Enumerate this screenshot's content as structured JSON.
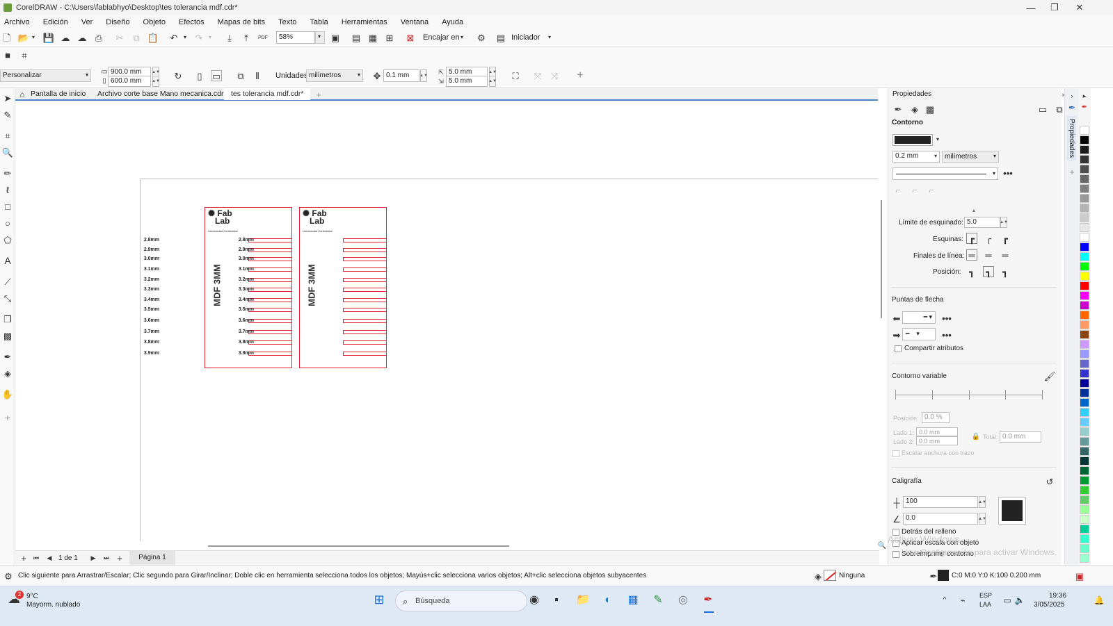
{
  "window": {
    "title": "CorelDRAW - C:\\Users\\fablabhyo\\Desktop\\tes tolerancia mdf.cdr*",
    "minimize": "—",
    "restore": "❐",
    "close": "✕"
  },
  "menu": [
    "Archivo",
    "Edición",
    "Ver",
    "Diseño",
    "Objeto",
    "Efectos",
    "Mapas de bits",
    "Texto",
    "Tabla",
    "Herramientas",
    "Ventana",
    "Ayuda"
  ],
  "toolbar": {
    "zoom": "58%",
    "fit_label": "Encajar en",
    "launcher_label": "Iniciador",
    "pdf_label": "PDF"
  },
  "propbar": {
    "preset": "Personalizar",
    "width": "900.0 mm",
    "height": "600.0 mm",
    "units_label": "Unidades:",
    "units": "milímetros",
    "nudge": "0.1 mm",
    "dup_x": "5.0 mm",
    "dup_y": "5.0 mm"
  },
  "tabs": [
    {
      "label": "Pantalla de inicio"
    },
    {
      "label": "Archivo corte base Mano mecanica.cdr"
    },
    {
      "label": "tes tolerancia mdf.cdr*"
    }
  ],
  "design": {
    "logo_top": "Fab",
    "logo_bottom": "Lab",
    "university": "Universidad Continental",
    "material": "MDF 3MM",
    "slots": [
      "2.8mm",
      "2.9mm",
      "3.0mm",
      "3.1mm",
      "3.2mm",
      "3.3mm",
      "3.4mm",
      "3.5mm",
      "3.6mm",
      "3.7mm",
      "3.8mm",
      "3.9mm"
    ]
  },
  "pagenav": {
    "count": "1 de 1",
    "page_tab": "Página 1"
  },
  "properties": {
    "title": "Propiedades",
    "side_tab": "Propiedades",
    "outline_section": "Contorno",
    "width": "0.2 mm",
    "width_units": "milímetros",
    "miter_label": "Límite de esquinado:",
    "miter_value": "5.0",
    "corners_label": "Esquinas:",
    "line_caps_label": "Finales de línea:",
    "position_label": "Posición:",
    "arrowheads_section": "Puntas de flecha",
    "share_attributes": "Compartir atributos",
    "variable_outline": "Contorno variable",
    "var_position_label": "Posición:",
    "var_position_value": "0.0 %",
    "side1_label": "Lado 1:",
    "side1_value": "0.0 mm",
    "side2_label": "Lado 2:",
    "side2_value": "0.0 mm",
    "total_label": "Total:",
    "total_value": "0.0 mm",
    "scale_width": "Escalar anchura con trazo",
    "calligraphy_section": "Caligrafía",
    "stretch": "100",
    "angle": "0.0",
    "behind_fill": "Detrás del relleno",
    "scale_with_object": "Aplicar escala con objeto",
    "overprint": "Sobreimprimir contorno",
    "outline_color": "#222222"
  },
  "watermark": {
    "line1": "Activar Windows",
    "line2": "Ve a Configuración para activar Windows."
  },
  "palette": [
    "#ffffff",
    "#000000",
    "#1a1a1a",
    "#333333",
    "#4d4d4d",
    "#666666",
    "#808080",
    "#999999",
    "#b3b3b3",
    "#cccccc",
    "#e6e6e6",
    "#ffffff",
    "#0000ff",
    "#00ffff",
    "#00ff00",
    "#ffff00",
    "#ff0000",
    "#ff00ff",
    "#cc00cc",
    "#ff6600",
    "#ff9966",
    "#8b4513",
    "#cc99ff",
    "#9999ff",
    "#6666cc",
    "#3333cc",
    "#000099",
    "#003399",
    "#0066cc",
    "#33ccff",
    "#66ccff",
    "#99cccc",
    "#669999",
    "#336666",
    "#003333",
    "#006633",
    "#009933",
    "#33cc33",
    "#66cc66",
    "#99ff99",
    "#ccffcc",
    "#00cc99",
    "#33ffcc",
    "#66ffcc",
    "#99ffcc"
  ],
  "status": {
    "hint": "Clic siguiente para Arrastrar/Escalar; Clic segundo para Girar/Inclinar; Doble clic en herramienta selecciona todos los objetos; Mayús+clic selecciona varios objetos; Alt+clic selecciona objetos subyacentes",
    "fill": "Ninguna",
    "outline": "C:0 M:0 Y:0 K:100  0.200 mm"
  },
  "taskbar": {
    "weather_temp": "9°C",
    "weather_desc": "Mayorm. nublado",
    "weather_badge": "2",
    "search": "Búsqueda",
    "lang1": "ESP",
    "lang2": "LAA",
    "time": "19:36",
    "date": "3/05/2025"
  }
}
